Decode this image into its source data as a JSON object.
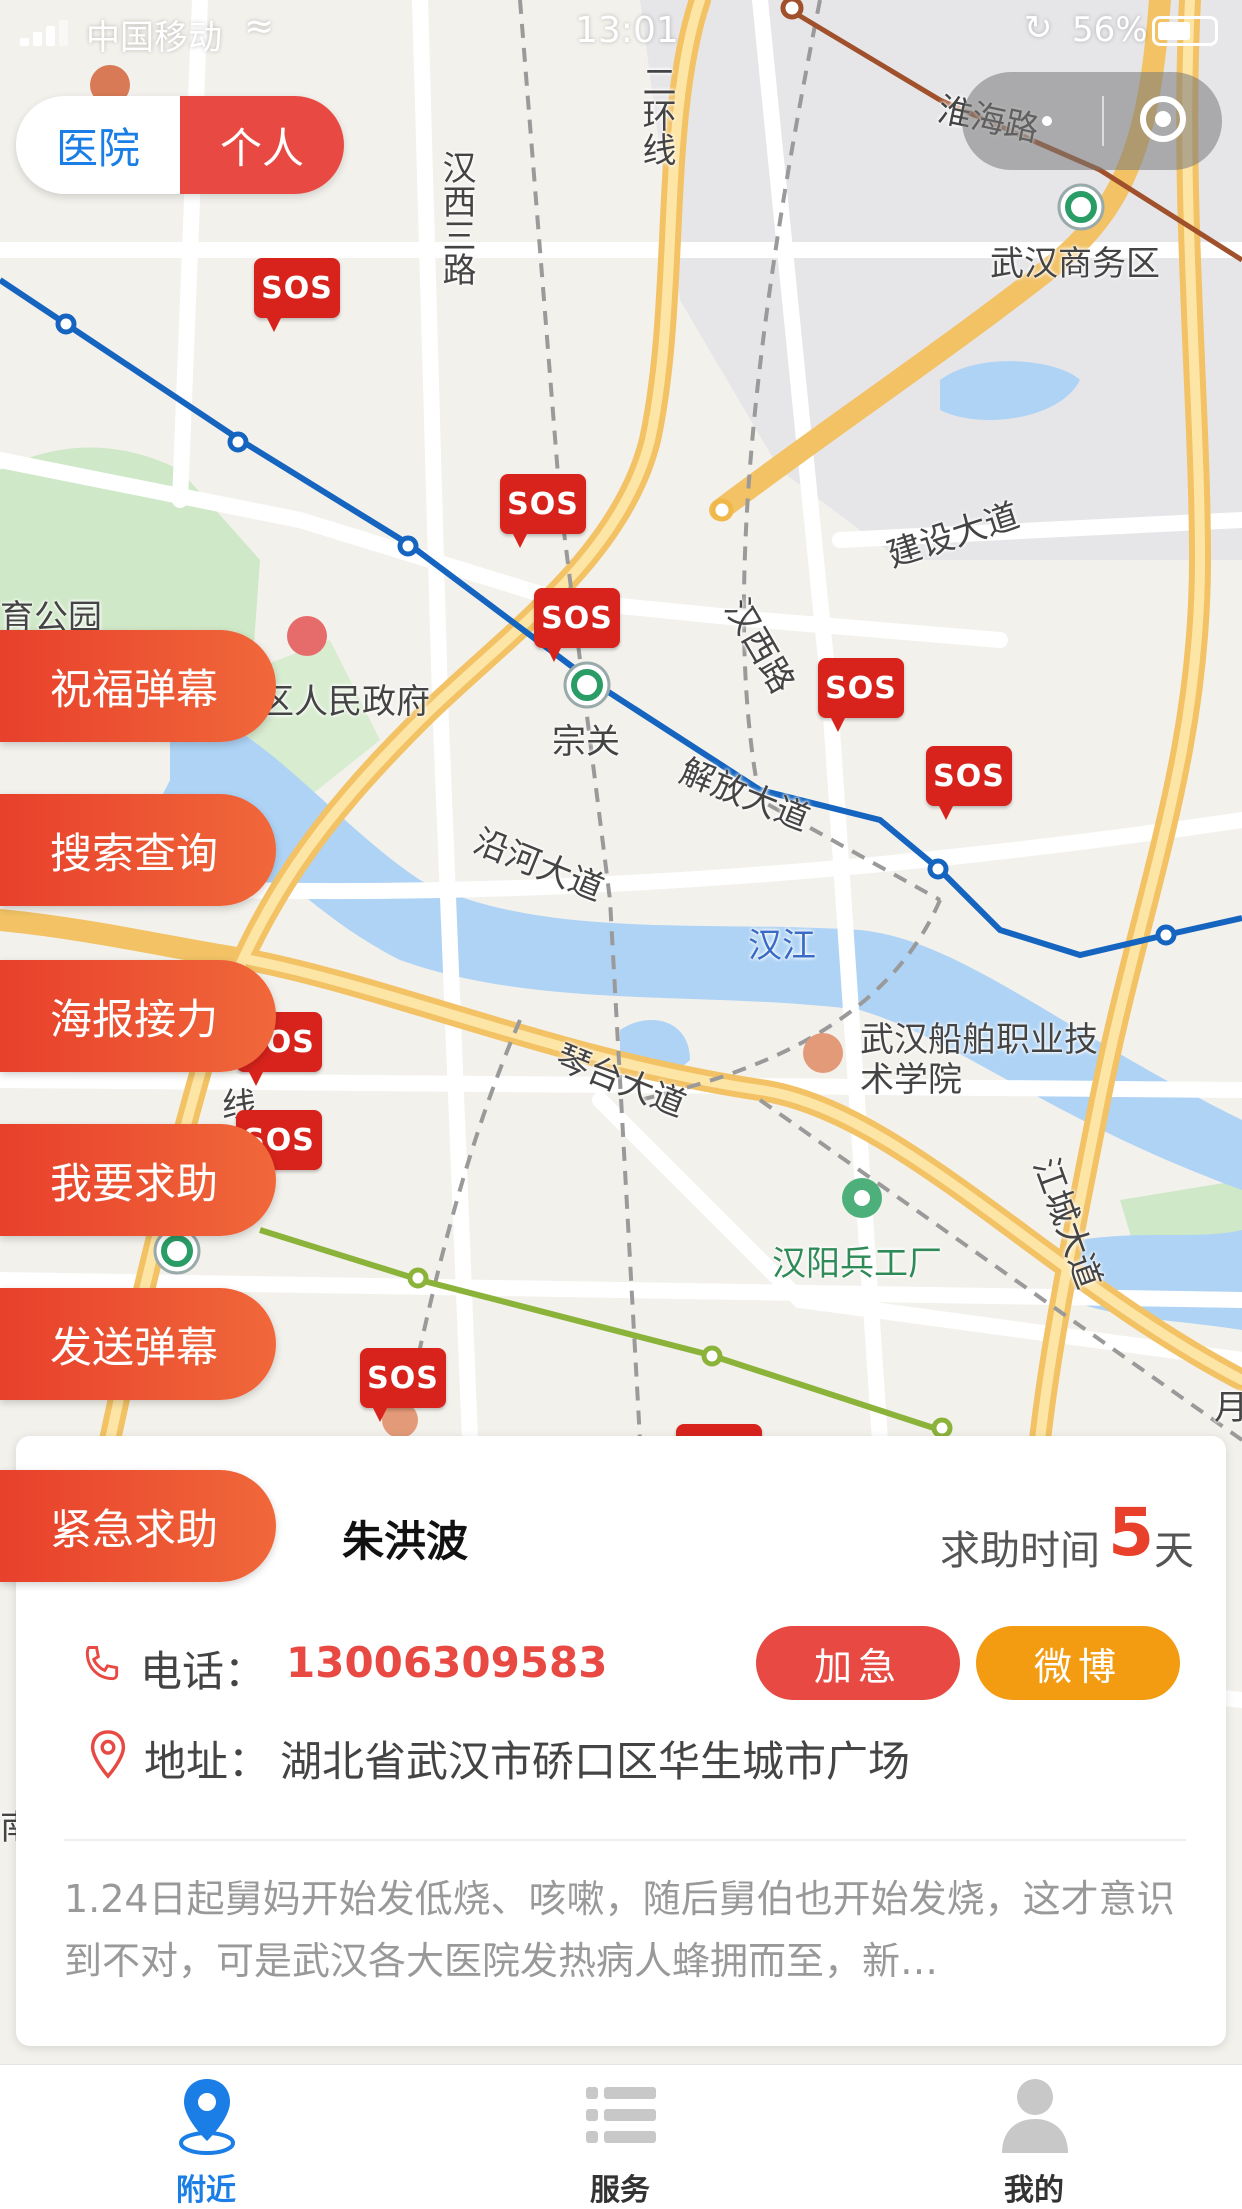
{
  "status_bar": {
    "carrier": "中国移动",
    "time": "13:01",
    "battery": "56%"
  },
  "toggle": {
    "left": "医院",
    "right": "个人",
    "selected": "个人"
  },
  "side_buttons": [
    "祝福弹幕",
    "搜索查询",
    "海报接力",
    "我要求助",
    "发送弹幕",
    "紧急求助"
  ],
  "map": {
    "labels": {
      "huaihai_road": "淮海路",
      "wuhan_cbd": "武汉商务区",
      "second_ring": "二环线",
      "hanxi_3rd_road": "汉西三路",
      "jianshe_avenue": "建设大道",
      "park": "育公园",
      "gov": "区人民政府",
      "zongguan": "宗关",
      "hanxi_road": "汉西路",
      "jiefang_avenue": "解放大道",
      "yanhe_avenue": "沿河大道",
      "hanjiang": "汉江",
      "qintai_avenue": "琴台大道",
      "shipbuilding_college": "武汉船舶职业技术学院",
      "hanyang_arsenal": "汉阳兵工厂",
      "jiangcheng_avenue": "江城大道",
      "west_road": "西路",
      "line": "线",
      "yue": "月",
      "nan": "南"
    },
    "marker_text": "SOS",
    "colors": {
      "metro_blue": "#1565c0",
      "metro_brown": "#a0502a",
      "river": "#aed3f5",
      "road_yellow": "#f7c96b",
      "sos_red": "#d8231d"
    }
  },
  "card": {
    "name": "朱洪波",
    "days_label": "求助时间",
    "days_value": "5",
    "days_unit": "天",
    "phone_label": "电话：",
    "phone": "13006309583",
    "address_label": "地址：",
    "address": "湖北省武汉市硚口区华生城市广场",
    "urgent_button": "加急",
    "weibo_button": "微博",
    "description": "1.24日起舅妈开始发低烧、咳嗽，随后舅伯也开始发烧，这才意识到不对，可是武汉各大医院发热病人蜂拥而至，新…"
  },
  "tabbar": {
    "items": [
      {
        "label": "附近",
        "icon": "location-pin-icon",
        "active": true
      },
      {
        "label": "服务",
        "icon": "list-icon",
        "active": false
      },
      {
        "label": "我的",
        "icon": "user-icon",
        "active": false
      }
    ],
    "active_color": "#1a7ee6"
  }
}
